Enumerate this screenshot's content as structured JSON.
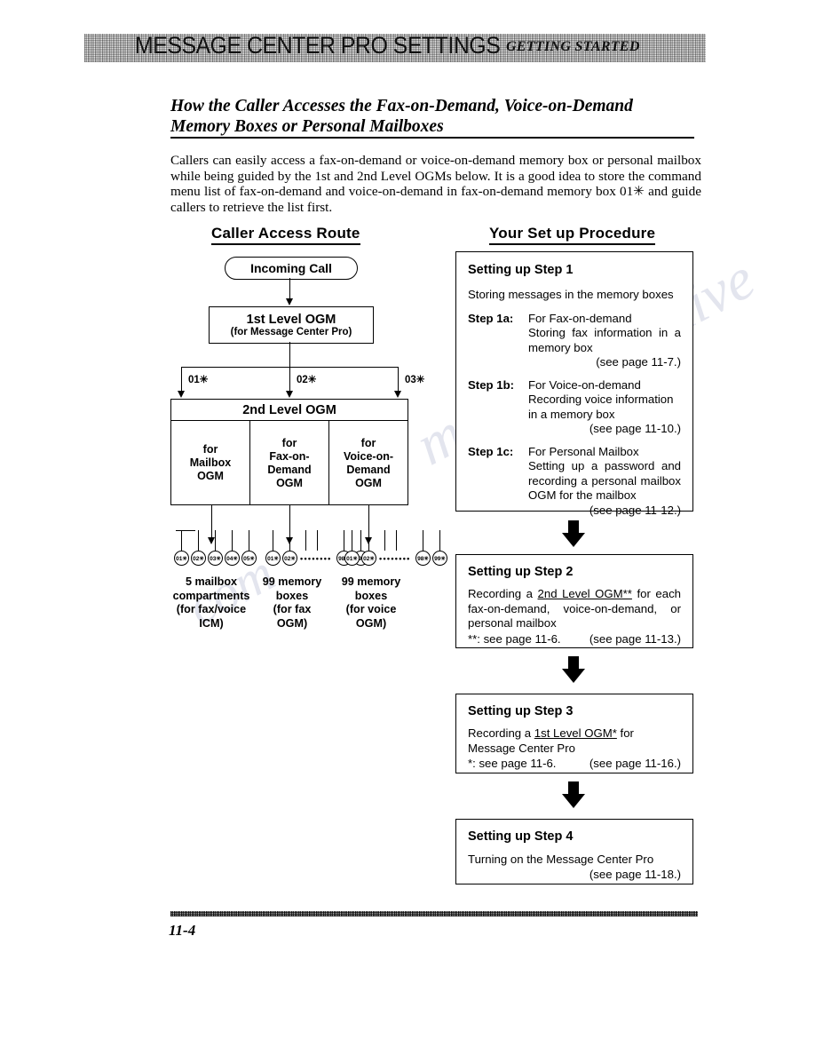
{
  "header": {
    "title": "MESSAGE CENTER PRO SETTINGS",
    "subtitle": "GETTING STARTED"
  },
  "section": {
    "heading": "How the Caller Accesses the Fax-on-Demand, Voice-on-Demand Memory Boxes or Personal Mailboxes",
    "intro": "Callers can easily access a fax-on-demand or voice-on-demand memory box or personal mailbox while being guided by the 1st and 2nd Level OGMs below. It is a good idea to store the command menu list of fax-on-demand and voice-on-demand in fax-on-demand memory box 01✳ and guide callers to retrieve the list first."
  },
  "left_column": {
    "title": "Caller Access Route",
    "incoming_call": "Incoming Call",
    "first_level": {
      "line1": "1st Level OGM",
      "line2": "(for Message Center Pro)"
    },
    "branch_labels": [
      "01✳",
      "02✳",
      "03✳"
    ],
    "second_level": {
      "header": "2nd Level OGM",
      "columns": [
        {
          "lines": [
            "for",
            "Mailbox",
            "OGM"
          ]
        },
        {
          "lines": [
            "for",
            "Fax-on-",
            "Demand",
            "OGM"
          ]
        },
        {
          "lines": [
            "for",
            "Voice-on-",
            "Demand",
            "OGM"
          ]
        }
      ]
    },
    "groups": [
      {
        "circles": [
          "01✳",
          "02✳",
          "03✳",
          "04✳",
          "05✳"
        ],
        "ellipsis": "",
        "caption": [
          "5 mailbox",
          "compartments",
          "(for fax/voice",
          "ICM)"
        ]
      },
      {
        "circles": [
          "01✳",
          "02✳",
          "98✳",
          "99✳"
        ],
        "ellipsis": "••••••••",
        "caption": [
          "99 memory",
          "boxes",
          "(for fax",
          "OGM)"
        ]
      },
      {
        "circles": [
          "01✳",
          "02✳",
          "98✳",
          "99✳"
        ],
        "ellipsis": "••••••••",
        "caption": [
          "99 memory",
          "boxes",
          "(for voice",
          "OGM)"
        ]
      }
    ]
  },
  "right_column": {
    "title": "Your Set up Procedure",
    "step1": {
      "title": "Setting up Step 1",
      "subtitle": "Storing messages in the memory boxes",
      "items": [
        {
          "label": "Step 1a:",
          "lines": [
            "For Fax-on-demand",
            "Storing fax information in a memory box"
          ],
          "page_ref": "(see page 11-7.)"
        },
        {
          "label": "Step 1b:",
          "lines": [
            "For Voice-on-demand",
            "Recording voice information in a memory box"
          ],
          "page_ref": "(see page 11-10.)"
        },
        {
          "label": "Step 1c:",
          "lines": [
            "For Personal Mailbox",
            "Setting up a password and recording a personal mailbox OGM for the mailbox"
          ],
          "page_ref": "(see page 11-12.)"
        }
      ]
    },
    "step2": {
      "title": "Setting up Step 2",
      "body_pre": "Recording a ",
      "body_link": "2nd Level OGM**",
      "body_post": " for each fax-on-demand, voice-on-demand, or personal mailbox",
      "footnote": "**: see page 11-6.",
      "page_ref": "(see page 11-13.)"
    },
    "step3": {
      "title": "Setting up Step 3",
      "body_pre": "Recording a ",
      "body_link": "1st Level OGM*",
      "body_post": " for Message Center Pro",
      "footnote": "*: see page 11-6.",
      "page_ref": "(see page 11-16.)"
    },
    "step4": {
      "title": "Setting up Step 4",
      "body": "Turning on the Message Center Pro",
      "page_ref": "(see page 11-18.)"
    }
  },
  "footer": {
    "page_number": "11-4"
  },
  "watermark": {
    "line1": "manualsarchive",
    "line2": "com"
  }
}
